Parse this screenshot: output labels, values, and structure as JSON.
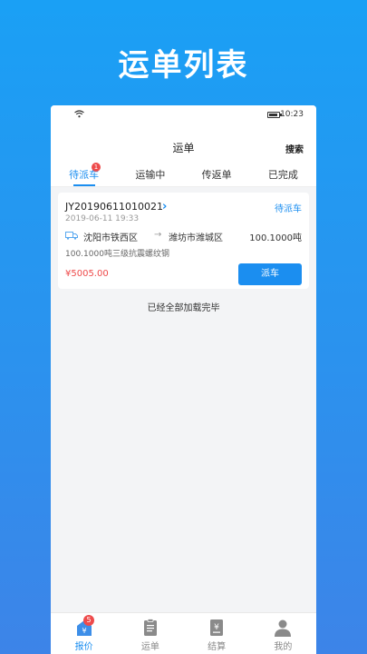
{
  "hero": {
    "title": "运单列表"
  },
  "status_bar": {
    "time": "10:23",
    "wifi_icon": "wifi-icon",
    "battery_icon": "battery-icon",
    "battery_level": 0.75
  },
  "nav": {
    "title": "运单",
    "search_label": "搜索"
  },
  "tabs": [
    {
      "label": "待派车",
      "active": true,
      "badge": "1"
    },
    {
      "label": "运输中",
      "active": false
    },
    {
      "label": "传返单",
      "active": false
    },
    {
      "label": "已完成",
      "active": false
    }
  ],
  "order": {
    "number": "JY20190611010021",
    "status": "待派车",
    "time": "2019-06-11 19:33",
    "from": "沈阳市铁西区",
    "to": "潍坊市潍城区",
    "weight": "100.1000吨",
    "goods": "100.1000吨三级抗震螺纹钢",
    "price": "¥5005.00",
    "dispatch_label": "派车"
  },
  "list_footer": "已经全部加载完毕",
  "bottom_nav": [
    {
      "label": "报价",
      "icon": "quote-icon",
      "active": true,
      "badge": "5"
    },
    {
      "label": "运单",
      "icon": "waybill-icon",
      "active": false
    },
    {
      "label": "结算",
      "icon": "settlement-icon",
      "active": false
    },
    {
      "label": "我的",
      "icon": "profile-icon",
      "active": false
    }
  ],
  "colors": {
    "accent": "#1b8ef0",
    "badge": "#ee4b4b",
    "price": "#ee4b4b"
  }
}
